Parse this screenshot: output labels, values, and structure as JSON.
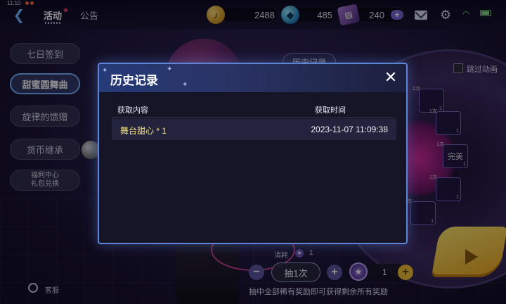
{
  "status_bar": {
    "time": "11:10"
  },
  "topbar": {
    "nav_activity": "活动",
    "nav_notice": "公告",
    "currencies": [
      {
        "name": "gold",
        "icon": "gold-note-icon",
        "value": "2488"
      },
      {
        "name": "gem",
        "icon": "blue-gem-icon",
        "value": "485"
      },
      {
        "name": "ticket",
        "icon": "ticket-icon",
        "value": "240"
      }
    ],
    "plus": "+"
  },
  "sidebar": {
    "items": [
      {
        "label": "七日签到"
      },
      {
        "label": "甜蜜圆舞曲",
        "active": true
      },
      {
        "label": "旋律的馈赠"
      },
      {
        "label": "货币继承"
      },
      {
        "label_line1": "福利中心",
        "label_line2": "礼包兑换"
      }
    ]
  },
  "stage": {
    "history_tab": "历史记录",
    "skip_animation": "跳过动画",
    "prize_slots": [
      {
        "count": "1次",
        "qty": "1"
      },
      {
        "count": "1次",
        "qty": "1"
      },
      {
        "count": "1次",
        "qty": "1",
        "label": "完美"
      },
      {
        "count": "1次",
        "qty": "1"
      },
      {
        "count": "1次",
        "qty": "1"
      }
    ]
  },
  "draw_controls": {
    "cost_label": "消耗",
    "cost_value": "1",
    "minus": "−",
    "draw_label": "抽1次",
    "plus": "+",
    "quantity": "1",
    "notice": "抽中全部稀有奖励即可获得剩余所有奖励"
  },
  "service": {
    "label": "客服"
  },
  "modal": {
    "title": "历史记录",
    "close": "✕",
    "columns": {
      "content": "获取内容",
      "time": "获取时间"
    },
    "rows": [
      {
        "content": "舞台甜心 * 1",
        "time": "2023-11-07 11:09:38"
      }
    ]
  },
  "colors": {
    "accent_blue": "#5d84d6",
    "reward_text": "#f4e37a",
    "play_button": "#f0a91a"
  }
}
